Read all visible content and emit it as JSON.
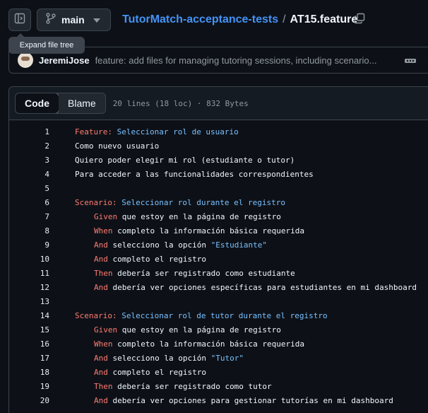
{
  "topbar": {
    "branch": "main",
    "repo": "TutorMatch-acceptance-tests",
    "separator": "/",
    "file": "AT15.feature"
  },
  "tooltip": "Expand file tree",
  "commit": {
    "author": "JeremiJose",
    "message": "feature: add files for managing tutoring sessions, including scenario..."
  },
  "file_header": {
    "code_tab": "Code",
    "blame_tab": "Blame",
    "meta": "20 lines (18 loc) · 832 Bytes"
  },
  "code": {
    "lines": [
      {
        "n": "1",
        "kw": "Feature",
        "colon": ":",
        "title": " Seleccionar rol de usuario",
        "text": "",
        "pre": "",
        "str": "",
        "indent": false
      },
      {
        "n": "2",
        "kw": "",
        "colon": "",
        "title": "",
        "text": "Como nuevo usuario",
        "pre": "",
        "str": "",
        "indent": false
      },
      {
        "n": "3",
        "kw": "",
        "colon": "",
        "title": "",
        "text": "Quiero poder elegir mi rol (estudiante o tutor)",
        "pre": "",
        "str": "",
        "indent": false
      },
      {
        "n": "4",
        "kw": "",
        "colon": "",
        "title": "",
        "text": "Para acceder a las funcionalidades correspondientes",
        "pre": "",
        "str": "",
        "indent": false
      },
      {
        "n": "5",
        "kw": "",
        "colon": "",
        "title": "",
        "text": "",
        "pre": "",
        "str": "",
        "indent": false
      },
      {
        "n": "6",
        "kw": "Scenario",
        "colon": ":",
        "title": " Seleccionar rol durante el registro",
        "text": "",
        "pre": "",
        "str": "",
        "indent": false
      },
      {
        "n": "7",
        "kw": "Given",
        "colon": "",
        "title": "",
        "text": " que estoy en la página de registro",
        "pre": "",
        "str": "",
        "indent": true
      },
      {
        "n": "8",
        "kw": "When",
        "colon": "",
        "title": "",
        "text": " completo la información básica requerida",
        "pre": "",
        "str": "",
        "indent": true
      },
      {
        "n": "9",
        "kw": "And",
        "colon": "",
        "title": "",
        "text": "",
        "pre": " selecciono la opción ",
        "str": "\"Estudiante\"",
        "indent": true
      },
      {
        "n": "10",
        "kw": "And",
        "colon": "",
        "title": "",
        "text": " completo el registro",
        "pre": "",
        "str": "",
        "indent": true
      },
      {
        "n": "11",
        "kw": "Then",
        "colon": "",
        "title": "",
        "text": " debería ser registrado como estudiante",
        "pre": "",
        "str": "",
        "indent": true
      },
      {
        "n": "12",
        "kw": "And",
        "colon": "",
        "title": "",
        "text": " debería ver opciones específicas para estudiantes en mi dashboard",
        "pre": "",
        "str": "",
        "indent": true
      },
      {
        "n": "13",
        "kw": "",
        "colon": "",
        "title": "",
        "text": "",
        "pre": "",
        "str": "",
        "indent": false
      },
      {
        "n": "14",
        "kw": "Scenario",
        "colon": ":",
        "title": " Seleccionar rol de tutor durante el registro",
        "text": "",
        "pre": "",
        "str": "",
        "indent": false
      },
      {
        "n": "15",
        "kw": "Given",
        "colon": "",
        "title": "",
        "text": " que estoy en la página de registro",
        "pre": "",
        "str": "",
        "indent": true
      },
      {
        "n": "16",
        "kw": "When",
        "colon": "",
        "title": "",
        "text": " completo la información básica requerida",
        "pre": "",
        "str": "",
        "indent": true
      },
      {
        "n": "17",
        "kw": "And",
        "colon": "",
        "title": "",
        "text": "",
        "pre": " selecciono la opción ",
        "str": "\"Tutor\"",
        "indent": true
      },
      {
        "n": "18",
        "kw": "And",
        "colon": "",
        "title": "",
        "text": " completo el registro",
        "pre": "",
        "str": "",
        "indent": true
      },
      {
        "n": "19",
        "kw": "Then",
        "colon": "",
        "title": "",
        "text": " debería ser registrado como tutor",
        "pre": "",
        "str": "",
        "indent": true
      },
      {
        "n": "20",
        "kw": "And",
        "colon": "",
        "title": "",
        "text": " debería ver opciones para gestionar tutorías en mi dashboard",
        "pre": "",
        "str": "",
        "indent": true
      }
    ]
  },
  "colors": {
    "background": "#0d1117",
    "link": "#4493f8",
    "keyword": "#ff7b72",
    "string": "#79c0ff"
  },
  "icons": [
    "sidebar-expand-icon",
    "git-branch-icon",
    "chevron-down-icon",
    "copy-icon",
    "kebab-horizontal-icon"
  ]
}
